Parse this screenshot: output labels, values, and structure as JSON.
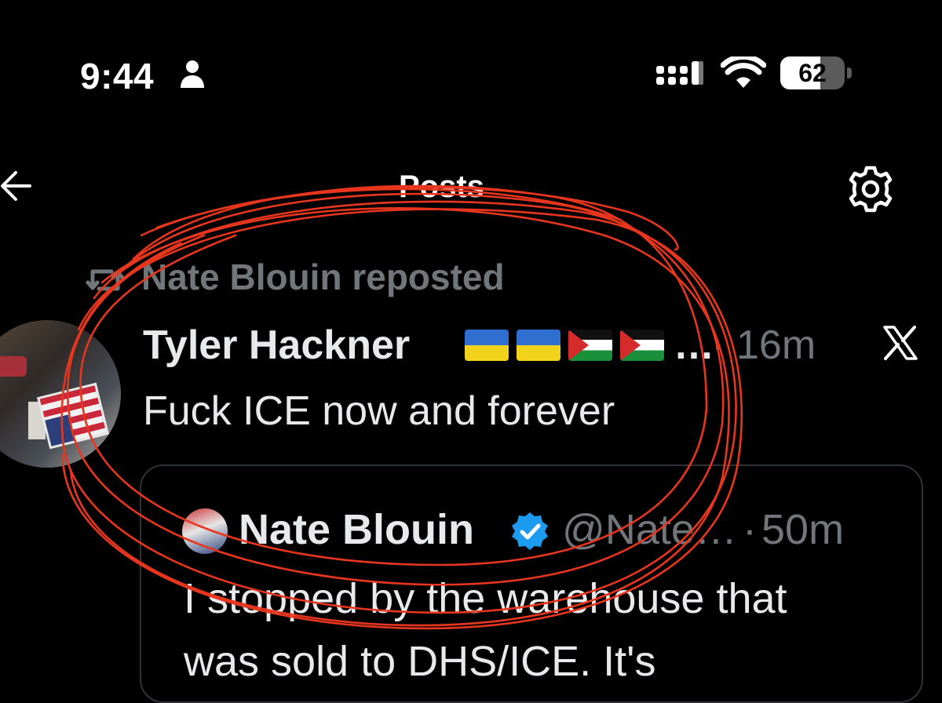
{
  "status_bar": {
    "time": "9:44",
    "battery_percent": "62",
    "battery_level": 0.62,
    "icons": [
      "person-icon",
      "signal-icon",
      "wifi-icon",
      "battery-icon"
    ]
  },
  "header": {
    "title": "Posts",
    "icons": [
      "back-arrow-icon",
      "settings-gear-icon"
    ]
  },
  "post": {
    "repost_text": "Nate Blouin reposted",
    "author_name": "Tyler Hackner",
    "name_flags": [
      "ukraine-flag",
      "ukraine-flag",
      "palestine-flag",
      "palestine-flag"
    ],
    "name_ellipsis": "…",
    "separator": "·",
    "time": "16m",
    "text": "Fuck ICE now and forever",
    "icons": [
      "repost-icon",
      "x-logo-icon"
    ]
  },
  "quoted_post": {
    "author_name": "Nate Blouin",
    "handle": "@Nate…",
    "separator": "·",
    "time": "50m",
    "text_line1": "I stopped by the warehouse that",
    "text_line2": "was sold to DHS/ICE. It's",
    "icons": [
      "verified-badge-icon"
    ]
  },
  "colors": {
    "background": "#000000",
    "text_primary": "#e7e9ea",
    "text_secondary": "#71767b",
    "verified_blue": "#1d9bf0",
    "annotation_red": "#e8361e"
  }
}
